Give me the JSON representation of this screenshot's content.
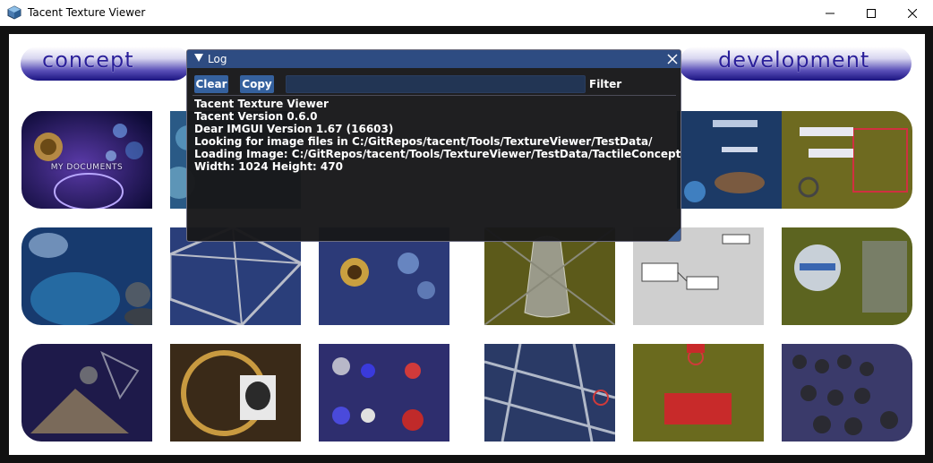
{
  "window": {
    "title": "Tacent Texture Viewer",
    "icon": "tacent-cube-icon"
  },
  "controls": {
    "minimize_icon": "minimize-icon",
    "maximize_icon": "maximize-icon",
    "close_icon": "close-icon"
  },
  "image": {
    "banner_left": "concept",
    "banner_right": "development",
    "thumbnail_labels": [
      "MY DOCUMENTS"
    ],
    "colors": {
      "banner_text": "#2a1f9a",
      "banner_dark": "#1a1380",
      "viewport_bg": "#111111"
    }
  },
  "log": {
    "title": "Log",
    "clear_label": "Clear",
    "copy_label": "Copy",
    "filter_value": "",
    "filter_label": "Filter",
    "lines": [
      "Tacent Texture Viewer",
      "Tacent Version 0.6.0",
      "Dear IMGUI Version 1.67 (16603)",
      "Looking for image files in C:/GitRepos/tacent/Tools/TextureViewer/TestData/",
      "Loading Image: C:/GitRepos/tacent/Tools/TextureViewer/TestData/TactileConceptDevelopment.jpg",
      "Width: 1024 Height: 470"
    ],
    "colors": {
      "title_bar": "#2e4c82",
      "button": "#35619e",
      "input": "#223554"
    }
  }
}
